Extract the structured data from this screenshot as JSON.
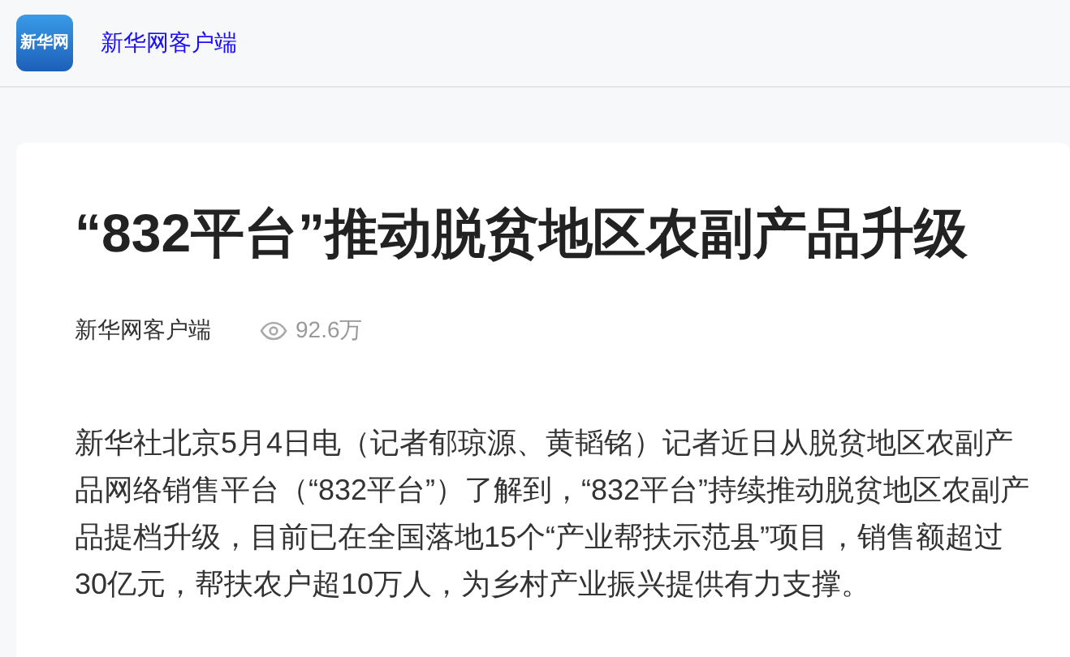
{
  "header": {
    "logo_text": "新华网",
    "site_name": "新华网客户端"
  },
  "article": {
    "title": "“832平台”推动脱贫地区农副产品升级",
    "source": "新华网客户端",
    "views": "92.6万",
    "body": "新华社北京5月4日电（记者郁琼源、黄韬铭）记者近日从脱贫地区农副产品网络销售平台（“832平台”）了解到，“832平台”持续推动脱贫地区农副产品提档升级，目前已在全国落地15个“产业帮扶示范县”项目，销售额超过30亿元，帮扶农户超10万人，为乡村产业振兴提供有力支撑。"
  }
}
